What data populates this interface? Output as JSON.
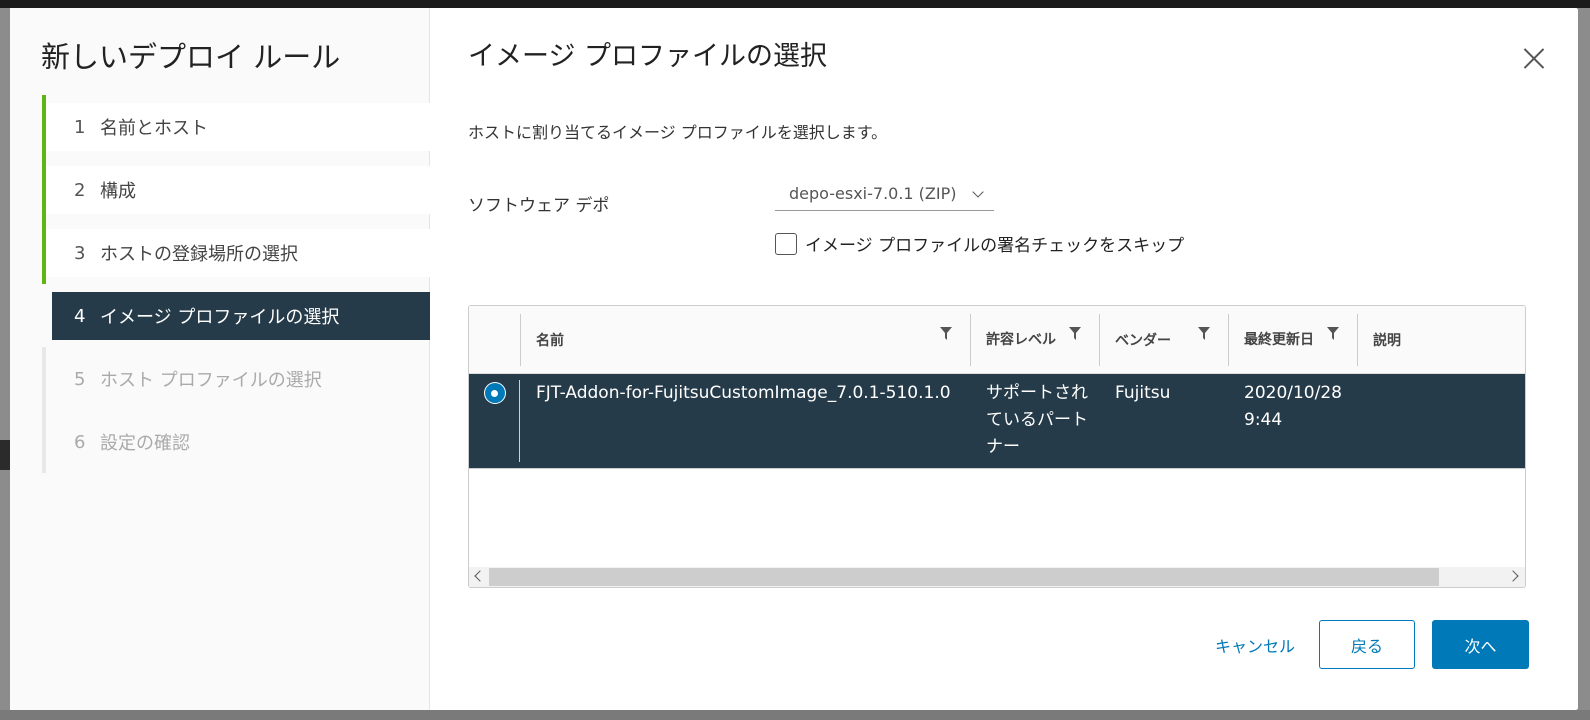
{
  "wizard": {
    "title": "新しいデプロイ ルール",
    "steps": [
      {
        "num": "1",
        "label": "名前とホスト"
      },
      {
        "num": "2",
        "label": "構成"
      },
      {
        "num": "3",
        "label": "ホストの登録場所の選択"
      },
      {
        "num": "4",
        "label": "イメージ プロファイルの選択"
      },
      {
        "num": "5",
        "label": "ホスト プロファイルの選択"
      },
      {
        "num": "6",
        "label": "設定の確認"
      }
    ]
  },
  "page": {
    "title": "イメージ プロファイルの選択",
    "description": "ホストに割り当てるイメージ プロファイルを選択します。",
    "depot_label": "ソフトウェア デポ",
    "depot_value": "depo-esxi-7.0.1 (ZIP)",
    "skip_check_label": "イメージ プロファイルの署名チェックをスキップ"
  },
  "grid": {
    "columns": {
      "name": "名前",
      "level": "許容レベル",
      "vendor": "ベンダー",
      "updated": "最終更新日",
      "description": "説明"
    },
    "rows": [
      {
        "name": "FJT-Addon-for-FujitsuCustomImage_7.0.1-510.1.0",
        "level": "サポートされているパートナー",
        "vendor": "Fujitsu",
        "updated": "2020/10/28 9:44",
        "description": ""
      }
    ]
  },
  "buttons": {
    "cancel": "キャンセル",
    "back": "戻る",
    "next": "次へ"
  },
  "colors": {
    "accent": "#0079b8",
    "selected": "#263b49",
    "progress": "#60b515"
  }
}
